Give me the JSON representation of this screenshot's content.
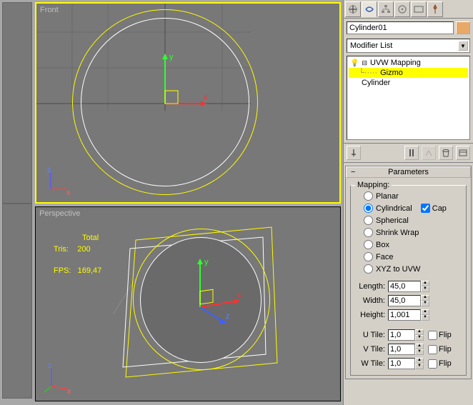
{
  "viewports": {
    "front": {
      "label": "Front",
      "axes": {
        "x": "x",
        "z": "z",
        "gx": "x",
        "gy": "y"
      }
    },
    "perspective": {
      "label": "Perspective",
      "stats": {
        "total_label": "Total",
        "tris_label": "Tris:",
        "tris_value": "200",
        "fps_label": "FPS:",
        "fps_value": "169,47"
      },
      "axes": {
        "x": "x",
        "z": "z",
        "gx": "x",
        "gy": "y",
        "gz": "z"
      }
    }
  },
  "panel": {
    "object_name": "Cylinder01",
    "modifier_list_label": "Modifier List",
    "stack": {
      "uvw": "UVW Mapping",
      "gizmo": "Gizmo",
      "base": "Cylinder"
    }
  },
  "parameters": {
    "title": "Parameters",
    "mapping_label": "Mapping:",
    "options": {
      "planar": "Planar",
      "cylindrical": "Cylindrical",
      "cap": "Cap",
      "spherical": "Spherical",
      "shrink": "Shrink Wrap",
      "box": "Box",
      "face": "Face",
      "xyz": "XYZ to UVW"
    },
    "length": {
      "label": "Length:",
      "value": "45,0"
    },
    "width": {
      "label": "Width:",
      "value": "45,0"
    },
    "height": {
      "label": "Height:",
      "value": "1,001"
    },
    "utile": {
      "label": "U Tile:",
      "value": "1,0",
      "flip": "Flip"
    },
    "vtile": {
      "label": "V Tile:",
      "value": "1,0",
      "flip": "Flip"
    },
    "wtile": {
      "label": "W Tile:",
      "value": "1,0",
      "flip": "Flip"
    }
  }
}
